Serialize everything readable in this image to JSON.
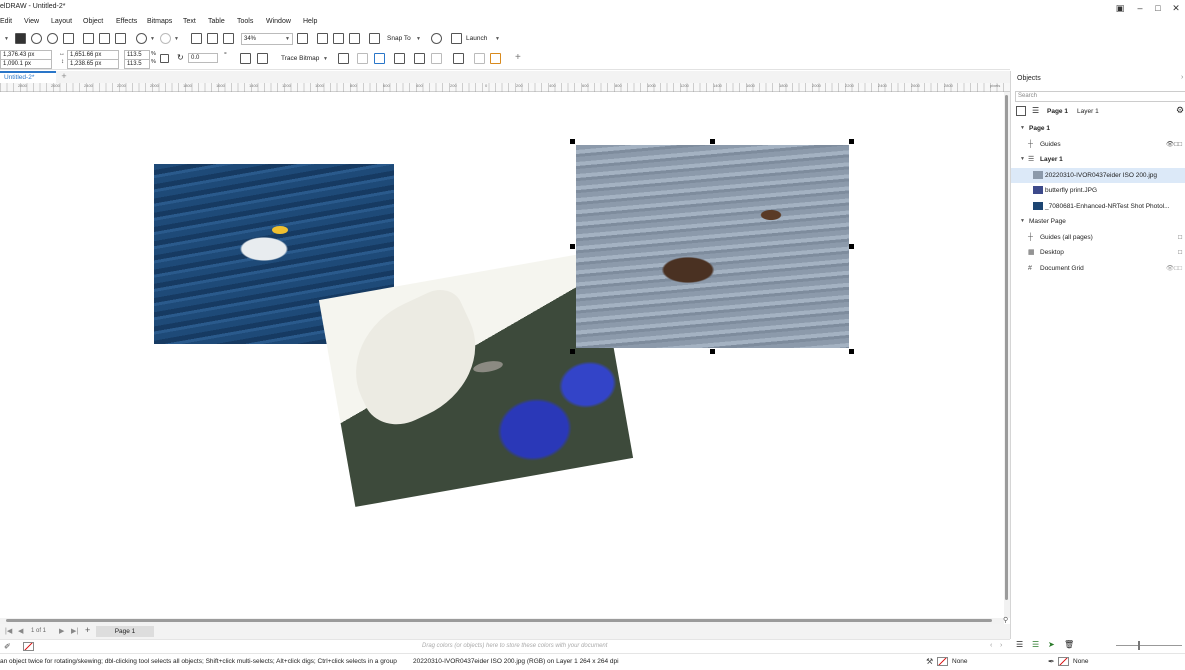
{
  "window": {
    "title": "elDRAW - Untitled-2*",
    "controls": [
      "user-icon",
      "minimize-icon",
      "maximize-icon",
      "close-icon"
    ]
  },
  "menu": [
    "Edit",
    "View",
    "Layout",
    "Object",
    "Effects",
    "Bitmaps",
    "Text",
    "Table",
    "Tools",
    "Window",
    "Help"
  ],
  "std_toolbar": {
    "zoom": "34%",
    "snap_to": "Snap To",
    "launch": "Launch"
  },
  "prop_toolbar": {
    "x": "1,376.43 px",
    "y": "1,090.1 px",
    "width": "1,651.66 px",
    "height": "1,238.65 px",
    "scale_x": "113.5",
    "scale_y": "113.5",
    "percent_x": "%",
    "percent_y": "%",
    "rotation": "0.0",
    "degree": "°",
    "trace_bitmap": "Trace Bitmap"
  },
  "document_tab": "Untitled-2*",
  "ruler": {
    "unit": "pixels",
    "ticks": [
      "2800",
      "2600",
      "2400",
      "2200",
      "2000",
      "1800",
      "1600",
      "1400",
      "1200",
      "1000",
      "800",
      "600",
      "400",
      "200",
      "0",
      "200",
      "400",
      "600",
      "800",
      "1000",
      "1200",
      "1400",
      "1600",
      "1800",
      "2000",
      "2200",
      "2400",
      "2600",
      "2800"
    ]
  },
  "page_nav": {
    "counter": "1 of 1",
    "page_tab": "Page 1"
  },
  "palette_hint": "Drag colors (or objects) here to store these colors with your document",
  "status": {
    "hint": "an object twice for rotating/skewing; dbl-clicking tool selects all objects; Shift+click multi-selects; Alt+click digs; Ctrl+click selects in a group",
    "selection_info": "20220310-IVOR0437eider ISO 200.jpg (RGB) on Layer 1  264 x 264 dpi",
    "fill": "None",
    "outline": "None"
  },
  "objects_panel": {
    "title": "Objects",
    "search_placeholder": "Search",
    "current_page": "Page 1",
    "current_layer": "Layer 1",
    "tree": {
      "page": "Page 1",
      "guides": "Guides",
      "layer": "Layer 1",
      "items": [
        {
          "name": "20220310-IVOR0437eider ISO 200.jpg",
          "selected": true
        },
        {
          "name": "butterfly print.JPG",
          "selected": false
        },
        {
          "name": "_7080681-Enhanced-NRTest Shot Photol...",
          "selected": false
        }
      ],
      "master_page": "Master Page",
      "master_items": [
        "Guides (all pages)",
        "Desktop",
        "Document Grid"
      ]
    }
  },
  "colors": {
    "accent": "#2a76c8",
    "selection_row": "#dce9f8",
    "handle": "#000000"
  }
}
